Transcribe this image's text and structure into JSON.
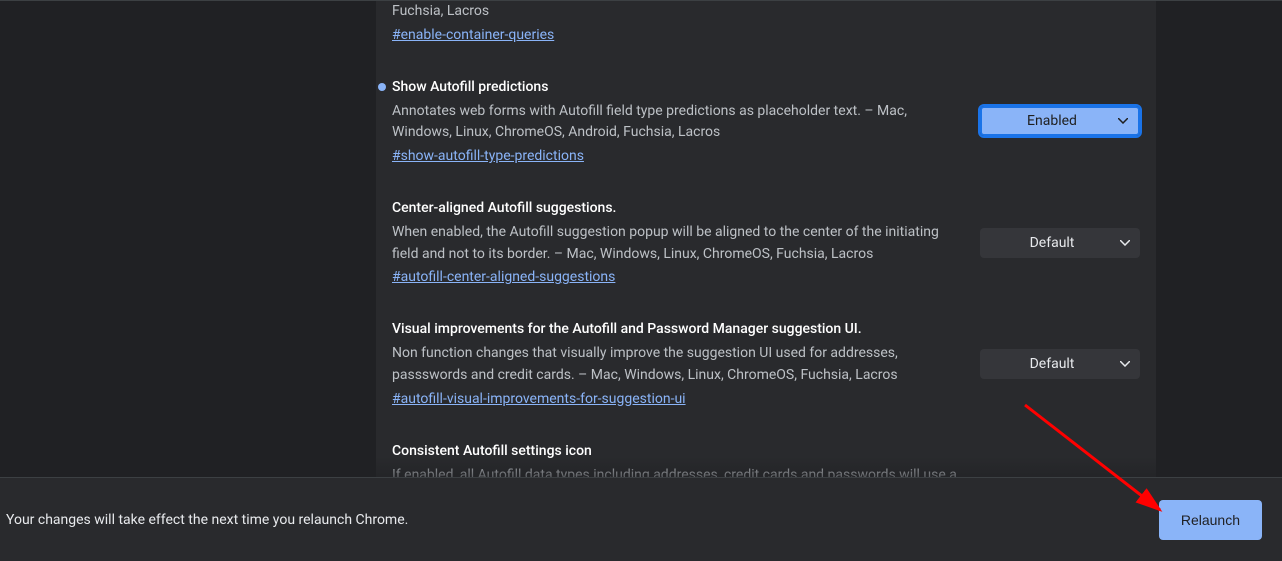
{
  "flags": [
    {
      "title": "",
      "desc_tail": "Fuchsia, Lacros",
      "hash": "#enable-container-queries",
      "select": null,
      "modified": false,
      "partial": "top"
    },
    {
      "title": "Show Autofill predictions",
      "desc": "Annotates web forms with Autofill field type predictions as placeholder text. – Mac, Windows, Linux, ChromeOS, Android, Fuchsia, Lacros",
      "hash": "#show-autofill-type-predictions",
      "select": "Enabled",
      "modified": true
    },
    {
      "title": "Center-aligned Autofill suggestions.",
      "desc": "When enabled, the Autofill suggestion popup will be aligned to the center of the initiating field and not to its border. – Mac, Windows, Linux, ChromeOS, Fuchsia, Lacros",
      "hash": "#autofill-center-aligned-suggestions",
      "select": "Default",
      "modified": false
    },
    {
      "title": "Visual improvements for the Autofill and Password Manager suggestion UI.",
      "desc": "Non function changes that visually improve the suggestion UI used for addresses, passswords and credit cards. – Mac, Windows, Linux, ChromeOS, Fuchsia, Lacros",
      "hash": "#autofill-visual-improvements-for-suggestion-ui",
      "select": "Default",
      "modified": false
    },
    {
      "title": "Consistent Autofill settings icon",
      "desc": "If enabled, all Autofill data types including addresses, credit cards and passwords will use a",
      "hash": "",
      "select": null,
      "modified": false,
      "partial": "bottom"
    }
  ],
  "restart": {
    "message": "Your changes will take effect the next time you relaunch Chrome.",
    "button": "Relaunch"
  },
  "colors": {
    "accent": "#8ab4f8",
    "arrow": "#ff0000"
  }
}
